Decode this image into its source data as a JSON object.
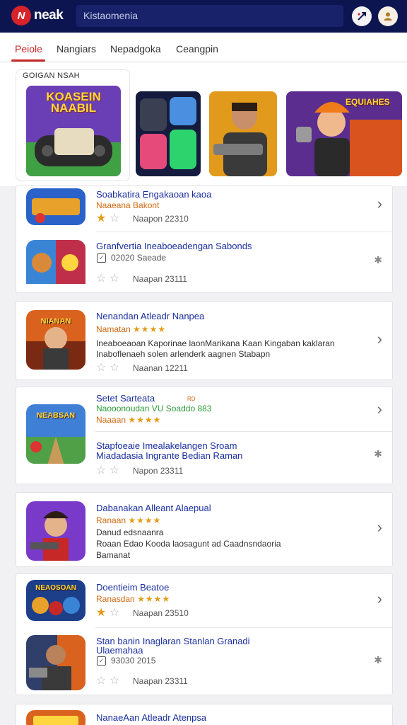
{
  "header": {
    "logo_mark": "N",
    "logo_text": "neak",
    "search_value": "Kistaomenia"
  },
  "tabs": [
    {
      "label": "Peiole"
    },
    {
      "label": "Nangiars"
    },
    {
      "label": "Nepadgoka"
    },
    {
      "label": "Ceangpin"
    }
  ],
  "featured": {
    "label": "GOIGAN NSAH",
    "hero_title": "KOASEIN NAABIL",
    "banner_title": "EQUIAHES"
  },
  "items": [
    {
      "title": "Soabkatira Engakaoan kaoa",
      "sub": "Naaeana Bakont",
      "meta": "Naapon 22310"
    },
    {
      "title": "Granfvertia Ineaboeadengan Sabonds",
      "check_label": "02020 Saeade",
      "meta": "Naapan 23111"
    },
    {
      "title": "Nenandan Atleadr Nanpea",
      "sub": "Namatan",
      "art": "NIANAN",
      "desc1": "Ineaboeaoan Kaporinae laonMarikana Kaan Kingaban kaklaran",
      "desc2": "Inaboflenaeh solen arlenderk aagnen Stabapn",
      "meta": "Naanan 12211"
    },
    {
      "title": "Setet Sarteata",
      "badge": "RD",
      "sub2": "Naooonoudan VU Soaddo 883",
      "sub": "Naaaan",
      "art": "NEABSAN",
      "title2": "Stapfoeaie Imealakelangen Sroam",
      "title3": "Miadadasia Ingrante Bedian Raman",
      "meta": "Napon 23311"
    },
    {
      "title": "Dabanakan Alleant Alaepual",
      "sub": "Ranaan",
      "desc1": "Danud edsnaanra",
      "desc2": "Roaan Edao Kooda laosagunt ad Caadnsndaoria",
      "desc3": "Bamanat"
    },
    {
      "title": "Doentieim Beatoe",
      "sub": "Ranasdan",
      "art": "NEAOSOAN",
      "meta": "Naapan 23510",
      "title2": "Stan banin Inaglaran Stanlan Granadi",
      "title3": "Ulaemahaa",
      "check_label": "93030 2015",
      "meta2": "Naapan 23311"
    },
    {
      "title": "NanaeAan Atleadr Atenpsa"
    }
  ],
  "colors": {
    "header": "#0c1550",
    "accent": "#c62828",
    "title": "#1a2fa0",
    "rating": "#e59a14"
  }
}
